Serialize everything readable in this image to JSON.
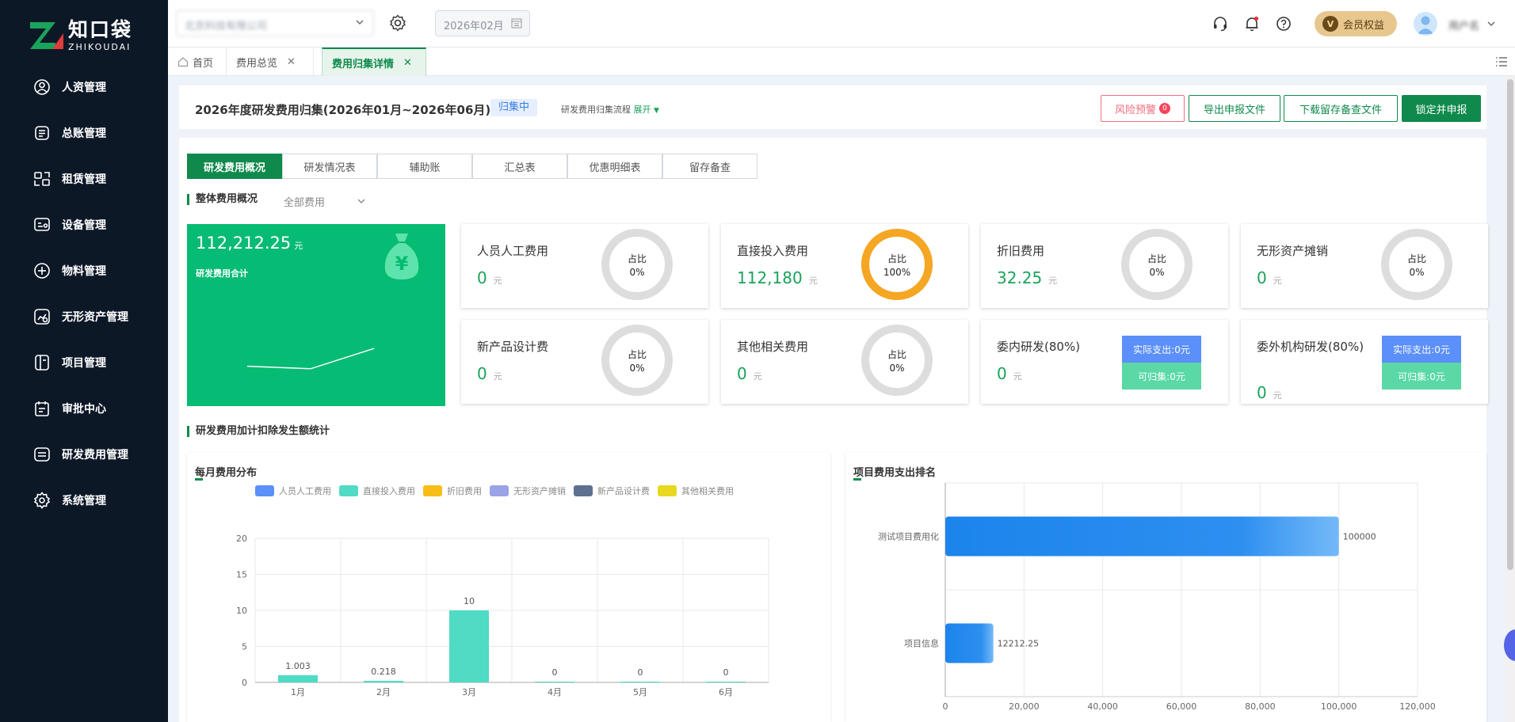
{
  "app": {
    "brand_cn": "知口袋",
    "brand_en": "ZHIKOUDAI"
  },
  "sidebar": {
    "items": [
      {
        "label": "人资管理",
        "icon": "user-circle-icon"
      },
      {
        "label": "总账管理",
        "icon": "ledger-icon"
      },
      {
        "label": "租赁管理",
        "icon": "lease-icon"
      },
      {
        "label": "设备管理",
        "icon": "device-icon"
      },
      {
        "label": "物料管理",
        "icon": "material-icon"
      },
      {
        "label": "无形资产管理",
        "icon": "intangible-asset-icon"
      },
      {
        "label": "项目管理",
        "icon": "project-icon"
      },
      {
        "label": "审批中心",
        "icon": "approval-icon"
      },
      {
        "label": "研发费用管理",
        "icon": "rd-expense-icon"
      },
      {
        "label": "系统管理",
        "icon": "settings-icon"
      }
    ]
  },
  "topbar": {
    "company": "北京科技有限公司",
    "month": "2026年02月",
    "member": "会员权益",
    "member_badge": "V",
    "username": "用户名"
  },
  "tabs": [
    {
      "label": "首页"
    },
    {
      "label": "费用总览"
    },
    {
      "label": "费用归集详情"
    }
  ],
  "header": {
    "title": "2026年度研发费用归集(2026年01月~2026年06月)",
    "status": "归集中",
    "flow_label": "研发费用归集流程",
    "flow_expand": "展开",
    "buttons": {
      "risk": "风险预警",
      "risk_count": "0",
      "export": "导出申报文件",
      "download": "下载留存备查文件",
      "lock": "锁定并申报"
    }
  },
  "subtabs": [
    "研发费用概况",
    "研发情况表",
    "辅助账",
    "汇总表",
    "优惠明细表",
    "留存备查"
  ],
  "overview": {
    "section_title": "整体费用概况",
    "filter": "全部费用",
    "total_value": "112,212.25",
    "total_unit": "元",
    "total_label": "研发费用合计",
    "spark": [
      0.2,
      0.1,
      0.9
    ]
  },
  "metrics": [
    {
      "name": "人员人工费用",
      "amount": "0",
      "unit": "元",
      "ratio_label": "占比",
      "ratio": "0%",
      "ratio_value": 0
    },
    {
      "name": "直接投入费用",
      "amount": "112,180",
      "unit": "元",
      "ratio_label": "占比",
      "ratio": "100%",
      "ratio_value": 100
    },
    {
      "name": "折旧费用",
      "amount": "32.25",
      "unit": "元",
      "ratio_label": "占比",
      "ratio": "0%",
      "ratio_value": 0
    },
    {
      "name": "无形资产摊销",
      "amount": "0",
      "unit": "元",
      "ratio_label": "占比",
      "ratio": "0%",
      "ratio_value": 0
    },
    {
      "name": "新产品设计费",
      "amount": "0",
      "unit": "元",
      "ratio_label": "占比",
      "ratio": "0%",
      "ratio_value": 0
    },
    {
      "name": "其他相关费用",
      "amount": "0",
      "unit": "元",
      "ratio_label": "占比",
      "ratio": "0%",
      "ratio_value": 0
    }
  ],
  "entrusted": [
    {
      "name": "委内研发(80%)",
      "amount": "0",
      "unit": "元",
      "actual": "实际支出:0元",
      "collectable": "可归集:0元"
    },
    {
      "name": "委外机构研发(80%)",
      "amount": "0",
      "unit": "元",
      "actual": "实际支出:0元",
      "collectable": "可归集:0元"
    }
  ],
  "stats_section_title": "研发费用加计扣除发生额统计",
  "colors": {
    "primary": "#0f8a4c",
    "total_card": "#06bb73",
    "ring_fill": "#f5a623",
    "ring_empty": "#dddddd",
    "actual_pill": "#5b8ff9",
    "collect_pill": "#5ad8a6"
  },
  "chart_data": [
    {
      "type": "bar",
      "title": "每月费用分布",
      "categories": [
        "1月",
        "2月",
        "3月",
        "4月",
        "5月",
        "6月"
      ],
      "series": [
        {
          "name": "人员人工费用",
          "color": "#5b8ff9",
          "values": [
            0,
            0,
            0,
            0,
            0,
            0
          ]
        },
        {
          "name": "直接投入费用",
          "color": "#4fdbc4",
          "values": [
            1.003,
            0.218,
            10,
            0,
            0,
            0
          ]
        },
        {
          "name": "折旧费用",
          "color": "#f6bd16",
          "values": [
            0,
            0,
            0,
            0,
            0,
            0
          ]
        },
        {
          "name": "无形资产摊销",
          "color": "#9aa3e6",
          "values": [
            0,
            0,
            0,
            0,
            0,
            0
          ]
        },
        {
          "name": "新产品设计费",
          "color": "#5d7092",
          "values": [
            0,
            0,
            0,
            0,
            0,
            0
          ]
        },
        {
          "name": "其他相关费用",
          "color": "#e8d81f",
          "values": [
            0,
            0,
            0,
            0,
            0,
            0
          ]
        }
      ],
      "data_labels": [
        "1.003",
        "0.218",
        "10",
        "0",
        "0",
        "0"
      ],
      "yticks": [
        "0",
        "5",
        "10",
        "15",
        "20"
      ],
      "ylim": [
        0,
        20
      ],
      "grid": true,
      "legend": "top"
    },
    {
      "type": "bar",
      "orientation": "horizontal",
      "title": "项目费用支出排名",
      "categories": [
        "测试项目费用化",
        "项目信息"
      ],
      "values": [
        100000,
        12212.25
      ],
      "data_labels": [
        "100000",
        "12212.25"
      ],
      "xticks": [
        "0",
        "20,000",
        "40,000",
        "60,000",
        "80,000",
        "100,000",
        "120,000"
      ],
      "xlim": [
        0,
        120000
      ],
      "grid": true
    }
  ]
}
